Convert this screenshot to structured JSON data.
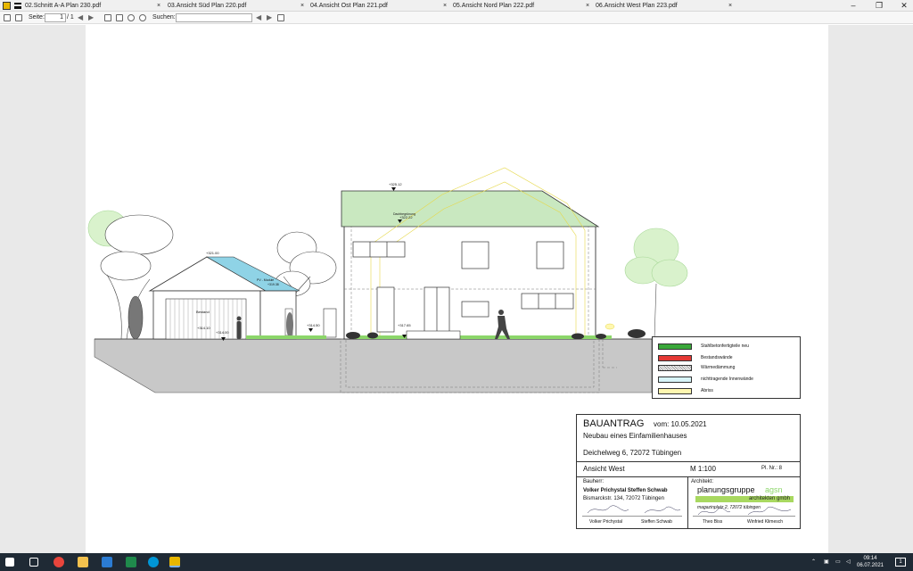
{
  "tabs": [
    {
      "label": "02.Schnitt A-A Plan 230.pdf",
      "close": "×"
    },
    {
      "label": "03.Ansicht Süd Plan 220.pdf",
      "close": "×"
    },
    {
      "label": "04.Ansicht Ost Plan 221.pdf",
      "close": "×"
    },
    {
      "label": "05.Ansicht Nord Plan 222.pdf",
      "close": "×"
    },
    {
      "label": "06.Ansicht West Plan 223.pdf",
      "close": "×"
    }
  ],
  "window_controls": {
    "minimize": "–",
    "maximize": "❐",
    "close": "✕"
  },
  "toolbar": {
    "page_label": "Seite:",
    "page_value": "1",
    "page_total": "/ 1",
    "search_label": "Suchen:",
    "search_value": ""
  },
  "drawing": {
    "elev_roof_top": "+325.12",
    "elev_ridge": "+322.22",
    "label_dachbegruenung": "Dachbegrünung",
    "elev_garage": "+321.00",
    "label_pv": "PV - Module",
    "label_pv_elev": "+319.38",
    "label_bestand": "Bestand",
    "elev_ground_1": "+314.10",
    "elev_ground_2": "+314.00",
    "elev_ground_3": "+314.50",
    "elev_floor": "+317.65"
  },
  "legend": [
    {
      "label": "Stahlbetonfertigteile neu",
      "color": "#3aa73a"
    },
    {
      "label": "Bestandswände",
      "color": "#e53935"
    },
    {
      "label": "Wärmedämmung",
      "color": "#ffffff"
    },
    {
      "label": "nichttragende Innenwände",
      "color": "#d8f4f8"
    },
    {
      "label": "Abriss",
      "color": "#fff7b0"
    }
  ],
  "titleblock": {
    "heading": "BAUANTRAG",
    "date": "vom: 10.05.2021",
    "project": "Neubau eines Einfamilienhauses",
    "address": "Deichelweg 6, 72072 Tübingen",
    "view": "Ansicht West",
    "scale": "M  1:100",
    "plan_no": "Pl. Nr.: 8",
    "bauherr_label": "Bauherr:",
    "bauherr_names": "Volker Prichystal Steffen Schwab",
    "bauherr_address": "Bismarckstr. 134, 72072 Tübingen",
    "sig_1": "Volker Prichystal",
    "sig_2": "Steffen Schwab",
    "architekt_label": "Architekt:",
    "firm_1": "planungsgruppe",
    "firm_1b": "agsn",
    "firm_2": "architekten gmbh",
    "firm_address": "magazinplatz 2,      72072 tübingen",
    "arch_sig_1": "Theo Biss",
    "arch_sig_2": "Winfried Klimesch"
  },
  "taskbar": {
    "time": "09:14",
    "date": "06.07.2021",
    "notification_count": "1"
  },
  "colors": {
    "green_roof": "#c9e8c0",
    "pv_panels": "#8fd3e6",
    "tree_green": "#d9f2cc",
    "grass": "#8cd66a",
    "ground": "#c8c8c8",
    "taskbar": "#1f2a35"
  }
}
